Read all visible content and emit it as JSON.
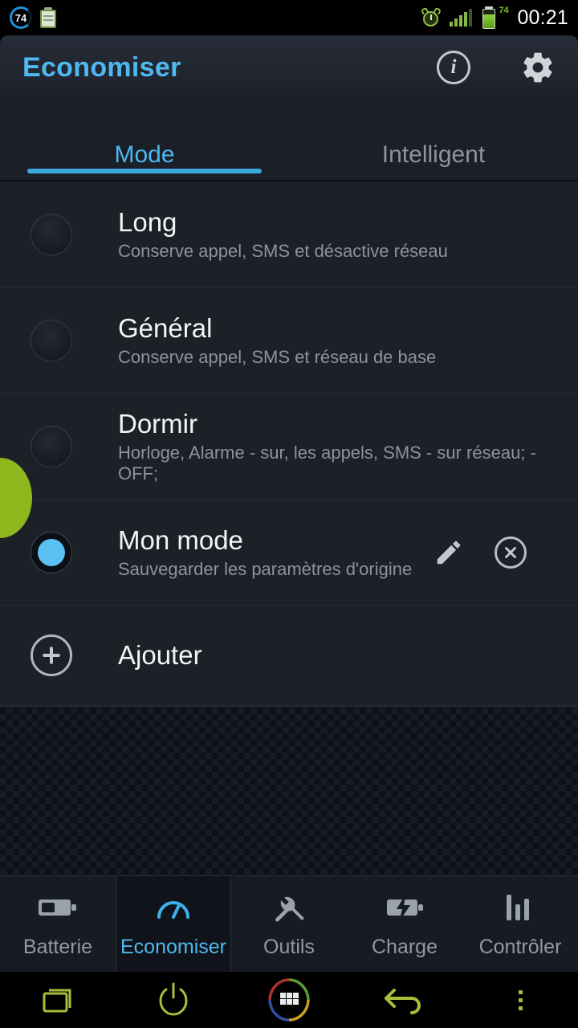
{
  "status_bar": {
    "badge_value": "74",
    "badge_icon": "circular-progress-badge",
    "clipboard_icon": "clipboard-icon",
    "alarm_icon": "alarm-clock-icon",
    "signal_icon": "signal-bars-icon",
    "battery_icon": "battery-icon",
    "battery_percent": "74",
    "clock": "00:21"
  },
  "app_bar": {
    "title": "Economiser",
    "info_label": "i",
    "info_icon": "info-icon",
    "settings_icon": "gear-icon",
    "title_color": "#4fb8ef"
  },
  "tabs": {
    "items": [
      {
        "label": "Mode",
        "active": true
      },
      {
        "label": "Intelligent",
        "active": false
      }
    ],
    "indicator_color": "#3ea9e0"
  },
  "modes": [
    {
      "title": "Long",
      "subtitle": "Conserve appel, SMS et désactive réseau",
      "selected": false,
      "editable": false
    },
    {
      "title": "Général",
      "subtitle": "Conserve appel, SMS et réseau de base",
      "selected": false,
      "editable": false
    },
    {
      "title": "Dormir",
      "subtitle": "Horloge, Alarme - sur, les appels, SMS - sur réseau; - OFF;",
      "selected": false,
      "editable": false
    },
    {
      "title": "Mon mode",
      "subtitle": "Sauvegarder les paramètres d'origine",
      "selected": true,
      "editable": true
    }
  ],
  "add_row": {
    "label": "Ajouter",
    "icon": "plus-circle-icon"
  },
  "row_actions": {
    "edit_icon": "pencil-icon",
    "delete_icon": "close-circle-icon"
  },
  "bottom_nav": {
    "items": [
      {
        "label": "Batterie",
        "icon": "battery-icon",
        "active": false
      },
      {
        "label": "Economiser",
        "icon": "gauge-icon",
        "active": true
      },
      {
        "label": "Outils",
        "icon": "tools-icon",
        "active": false
      },
      {
        "label": "Charge",
        "icon": "battery-charge-icon",
        "active": false
      },
      {
        "label": "Contrôler",
        "icon": "bar-chart-icon",
        "active": false
      }
    ],
    "active_color": "#4fb8ef",
    "inactive_color": "#9199a3"
  },
  "android_nav": {
    "items": [
      {
        "icon": "recents-icon"
      },
      {
        "icon": "power-icon"
      },
      {
        "icon": "home-apps-icon"
      },
      {
        "icon": "back-icon"
      },
      {
        "icon": "overflow-menu-icon"
      }
    ],
    "color": "#a8be3a"
  },
  "overlay": {
    "floating_blob_color": "#8fb81f",
    "floating_blob_name": "floating-bubble"
  }
}
